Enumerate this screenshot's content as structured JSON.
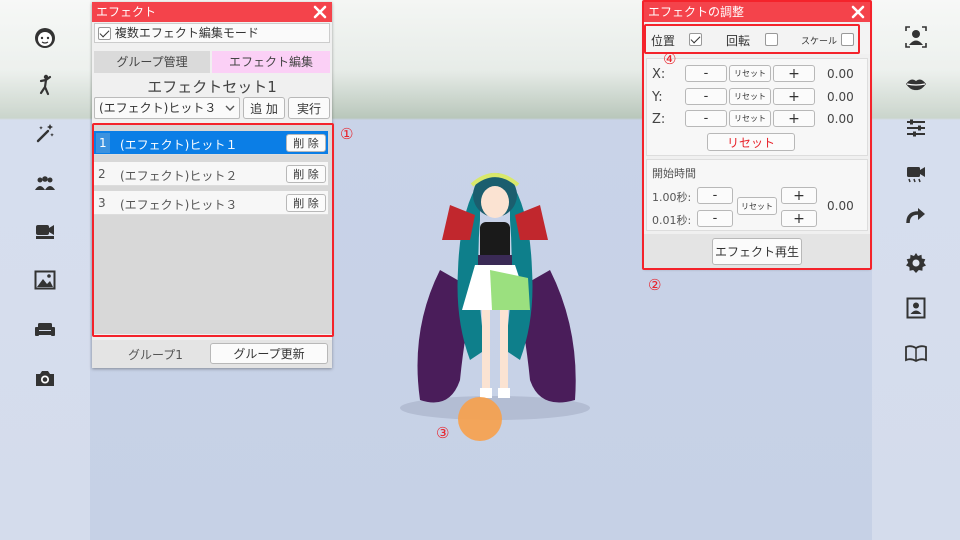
{
  "left_sidebar": {
    "icons": [
      "face-icon",
      "pose-icon",
      "magic-wand-icon",
      "group-icon",
      "video-camera-icon",
      "image-icon",
      "sofa-icon",
      "camera-icon"
    ]
  },
  "right_sidebar": {
    "icons": [
      "portrait-icon",
      "lips-icon",
      "sliders-icon",
      "movie-camera-icon",
      "redo-arrow-icon",
      "settings-icon",
      "contact-card-icon",
      "book-icon"
    ]
  },
  "effect_panel": {
    "title": "エフェクト",
    "multi_edit_label": "複数エフェクト編集モード",
    "multi_edit_checked": true,
    "tabs": [
      {
        "label": "グループ管理",
        "active": false
      },
      {
        "label": "エフェクト編集",
        "active": true
      }
    ],
    "set_title": "エフェクトセット1",
    "dropdown_value": "(エフェクト)ヒット３",
    "add_label": "追 加",
    "run_label": "実行",
    "rows": [
      {
        "num": "1",
        "name": "(エフェクト)ヒット１",
        "delete": "削 除",
        "selected": true
      },
      {
        "num": "2",
        "name": "(エフェクト)ヒット２",
        "delete": "削 除",
        "selected": false
      },
      {
        "num": "3",
        "name": "(エフェクト)ヒット３",
        "delete": "削 除",
        "selected": false
      }
    ],
    "group_label": "グループ1",
    "group_update_label": "グループ更新"
  },
  "adjust_panel": {
    "title": "エフェクトの調整",
    "mode_position": "位置",
    "mode_position_checked": true,
    "mode_rotation": "回転",
    "mode_rotation_checked": false,
    "mode_scale": "スケール",
    "mode_scale_checked": false,
    "axes": [
      {
        "label": "X:",
        "minus": "-",
        "reset": "リセット",
        "plus": "+",
        "value": "0.00"
      },
      {
        "label": "Y:",
        "minus": "-",
        "reset": "リセット",
        "plus": "+",
        "value": "0.00"
      },
      {
        "label": "Z:",
        "minus": "-",
        "reset": "リセット",
        "plus": "+",
        "value": "0.00"
      }
    ],
    "reset_all": "リセット",
    "start_time_label": "開始時間",
    "step_1": "1.00秒:",
    "step_2": "0.01秒:",
    "time_minus": "-",
    "time_plus": "+",
    "time_reset": "リセット",
    "time_value": "0.00",
    "play_label": "エフェクト再生"
  },
  "markers": {
    "m1": "①",
    "m2": "②",
    "m3": "③",
    "m4": "④"
  },
  "colors": {
    "title_bar": "#f4434b",
    "highlight_red": "#f4232b",
    "selected_row": "#0b7ee6",
    "active_tab": "#fbd0f6",
    "effect_orb": "#f7a04a"
  }
}
